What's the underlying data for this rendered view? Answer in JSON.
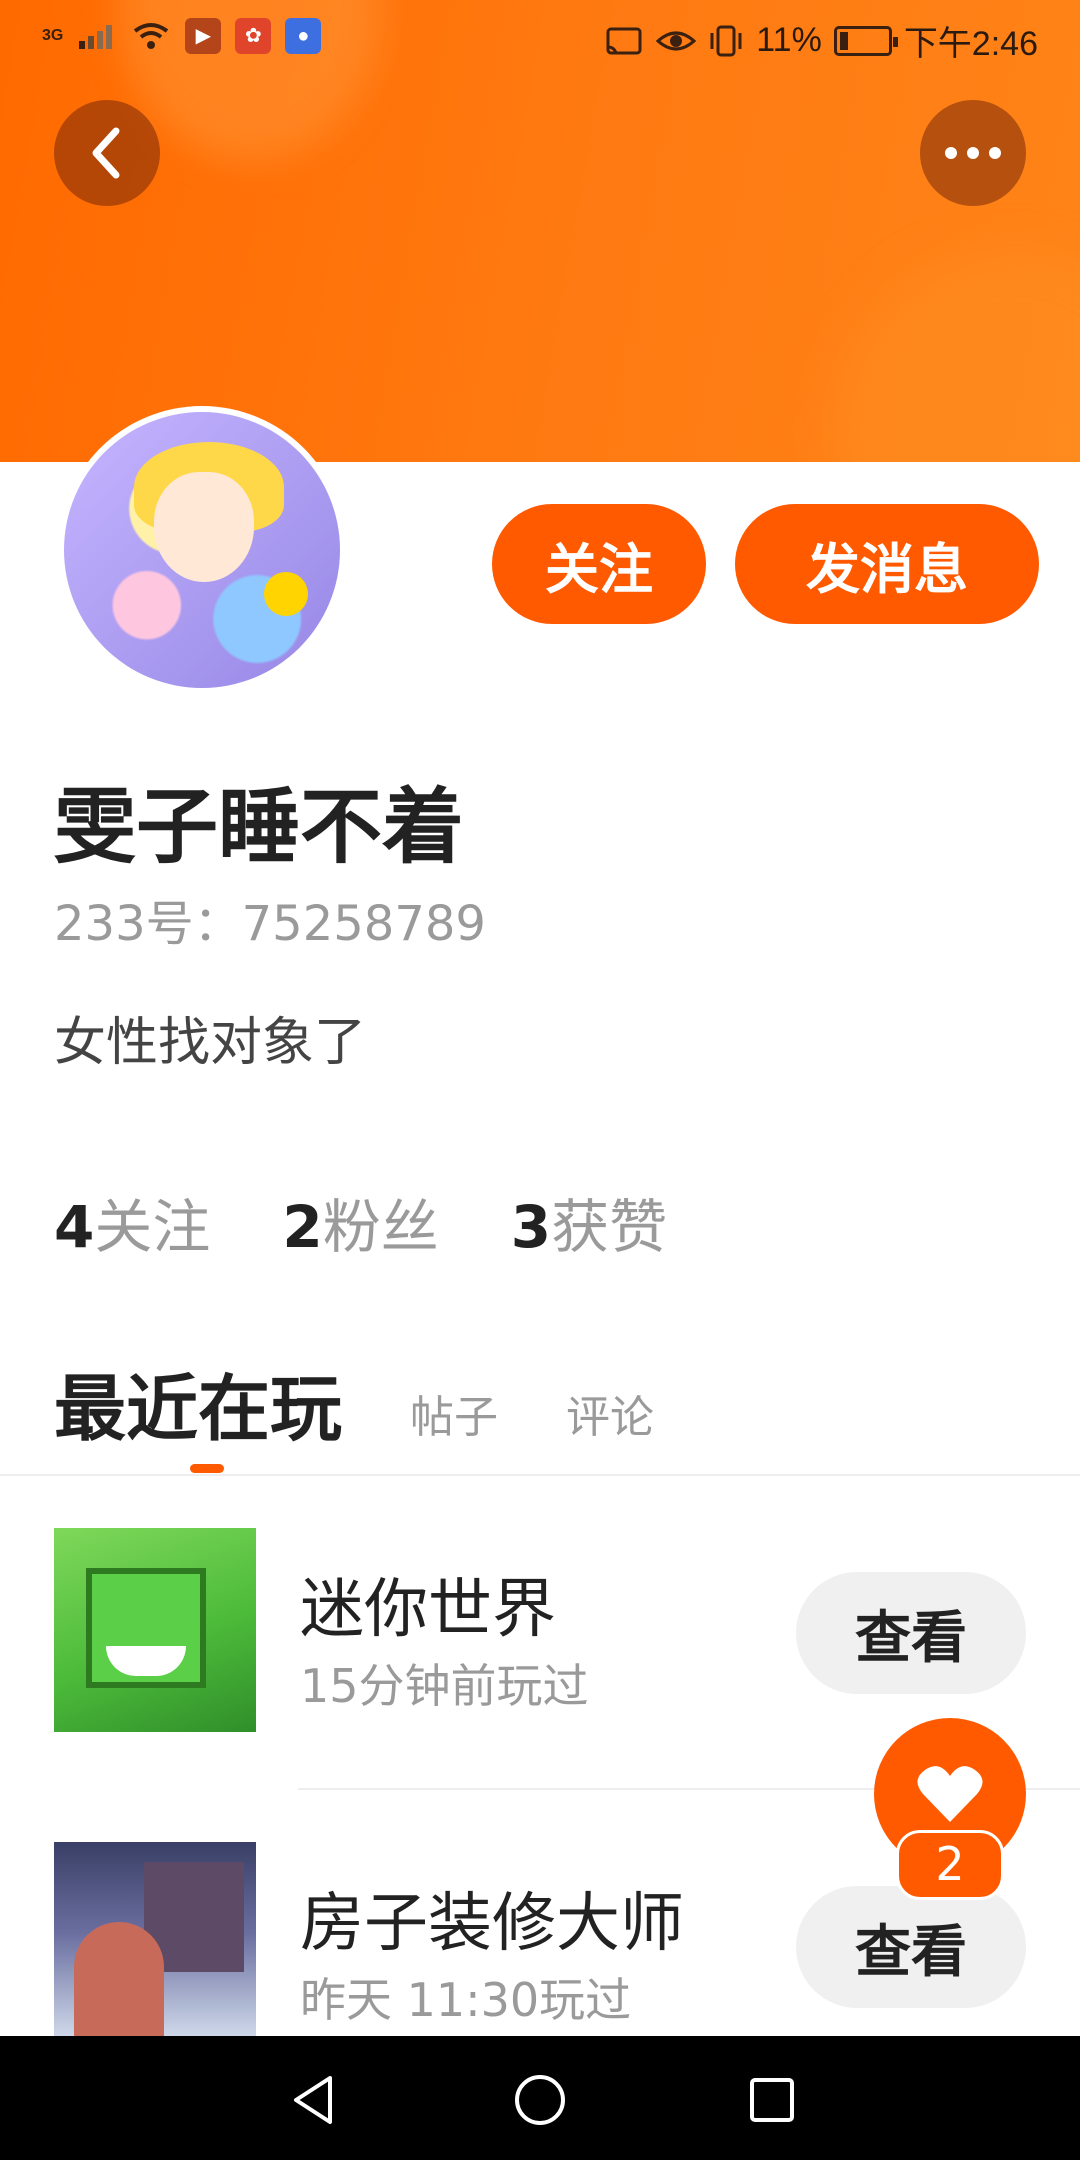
{
  "status_bar": {
    "network": "3G",
    "battery": "11%",
    "time": "下午2:46"
  },
  "profile": {
    "name": "雯子睡不着",
    "uid": "233号：75258789",
    "bio": "女性找对象了",
    "follow_label": "关注",
    "message_label": "发消息"
  },
  "stats": [
    {
      "num": "4",
      "label": "关注"
    },
    {
      "num": "2",
      "label": "粉丝"
    },
    {
      "num": "3",
      "label": "获赞"
    }
  ],
  "tabs": [
    {
      "label": "最近在玩",
      "active": true
    },
    {
      "label": "帖子",
      "active": false
    },
    {
      "label": "评论",
      "active": false
    }
  ],
  "games": [
    {
      "title": "迷你世界",
      "time": "15分钟前玩过",
      "button": "查看"
    },
    {
      "title": "房子装修大师",
      "time": "昨天 11:30玩过",
      "button": "查看"
    }
  ],
  "fab": {
    "icon": "heart-icon",
    "badge": "2"
  },
  "colors": {
    "accent": "#ff5a00",
    "banner": "#ff7a12"
  }
}
